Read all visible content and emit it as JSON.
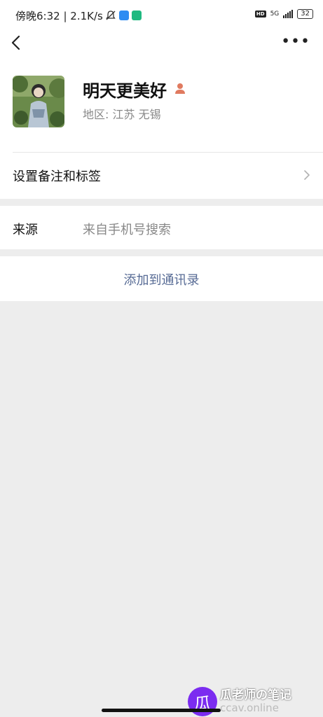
{
  "status_bar": {
    "time_text": "傍晚6:32 | 2.1K/s",
    "network": "5G",
    "hd": "HD",
    "battery": "32"
  },
  "nav": {
    "more_label": "•••"
  },
  "profile": {
    "name": "明天更美好",
    "region": "地区:  江苏  无锡"
  },
  "rows": {
    "remark_label": "设置备注和标签",
    "source_label": "来源",
    "source_value": "来自手机号搜索"
  },
  "action": {
    "add_contact": "添加到通讯录"
  },
  "watermark": {
    "logo": "瓜",
    "title": "瓜老师の笔记",
    "url": "ccav.online"
  },
  "colors": {
    "link_blue": "#576b95",
    "page_bg": "#ededed",
    "secondary_text": "#888888"
  }
}
